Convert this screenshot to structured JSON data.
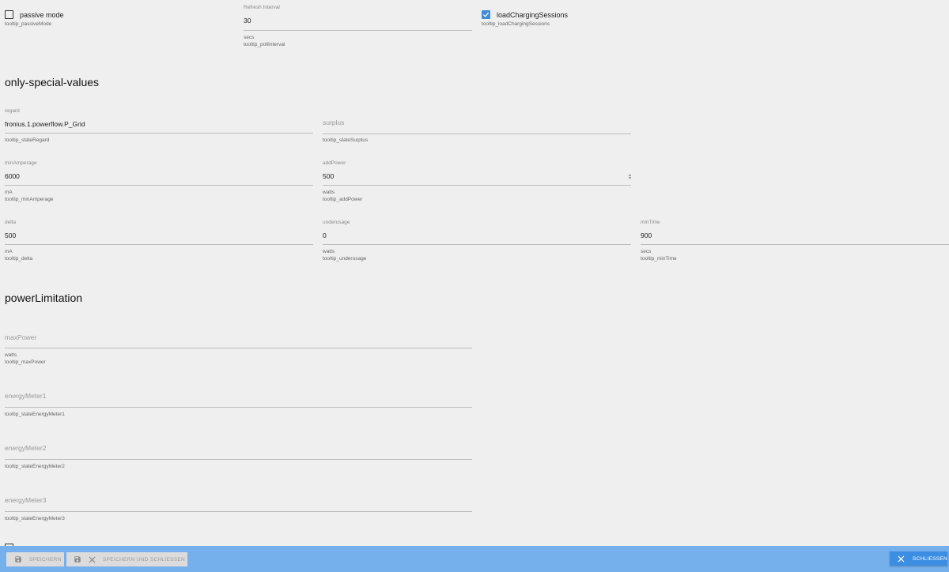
{
  "top": {
    "passive": {
      "label": "passive mode",
      "tooltip": "tooltip_passiveMode",
      "checked": false
    },
    "refresh": {
      "label": "Refresh Interval",
      "value": "30",
      "unit": "secs",
      "tooltip": "tooltip_pollInterval"
    },
    "loadCharging": {
      "label": "loadChargingSessions",
      "tooltip": "tooltip_loadChargingSessions",
      "checked": true
    }
  },
  "special": {
    "title": "only-special-values",
    "regard": {
      "label": "regard",
      "value": "fronius.1.powerflow.P_Grid",
      "tooltip": "tooltip_stateRegard"
    },
    "surplus": {
      "placeholder": "surplus",
      "tooltip": "tooltip_stateSurplus"
    },
    "minAmperage": {
      "label": "minAmperage",
      "value": "6000",
      "unit": "mA",
      "tooltip": "tooltip_minAmperage"
    },
    "addPower": {
      "label": "addPower",
      "value": "500",
      "unit": "watts",
      "tooltip": "tooltip_addPower"
    },
    "delta": {
      "label": "delta",
      "value": "500",
      "unit": "mA",
      "tooltip": "tooltip_delta"
    },
    "underusage": {
      "label": "underusage",
      "value": "0",
      "unit": "watts",
      "tooltip": "tooltip_underusage"
    },
    "minTime": {
      "label": "minTime",
      "value": "900",
      "unit": "secs",
      "tooltip": "tooltip_minTime"
    }
  },
  "power": {
    "title": "powerLimitation",
    "maxPower": {
      "placeholder": "maxPower",
      "unit": "watts",
      "tooltip": "tooltip_maxPower"
    },
    "energyMeter1": {
      "placeholder": "energyMeter1",
      "tooltip": "tooltip_stateEnergyMeter1"
    },
    "energyMeter2": {
      "placeholder": "energyMeter2",
      "tooltip": "tooltip_stateEnergyMeter2"
    },
    "energyMeter3": {
      "placeholder": "energyMeter3",
      "tooltip": "tooltip_stateEnergyMeter3"
    }
  },
  "footer": {
    "save": "Speichern",
    "saveClose": "Speichern und schliessen",
    "close": "schliessen",
    "bar_color": "#76b0ec",
    "close_color": "#3b8ee2"
  },
  "accent": "#3f8ed8"
}
